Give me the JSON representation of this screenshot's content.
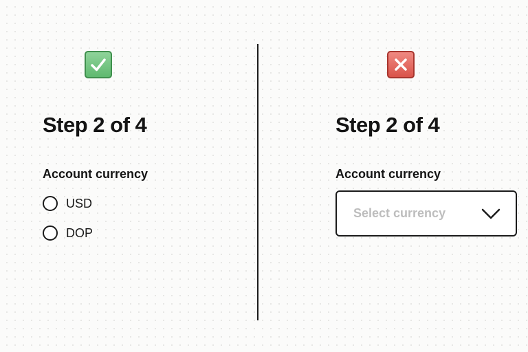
{
  "good_example": {
    "badge_icon": "check-mark-icon",
    "badge_color": "#5fb96f",
    "step_title": "Step 2 of 4",
    "field_label": "Account currency",
    "options": [
      {
        "label": "USD",
        "selected": false
      },
      {
        "label": "DOP",
        "selected": false
      }
    ]
  },
  "bad_example": {
    "badge_icon": "cross-mark-icon",
    "badge_color": "#d9534a",
    "step_title": "Step 2 of 4",
    "field_label": "Account currency",
    "select": {
      "placeholder": "Select currency",
      "icon": "chevron-down-icon"
    }
  }
}
